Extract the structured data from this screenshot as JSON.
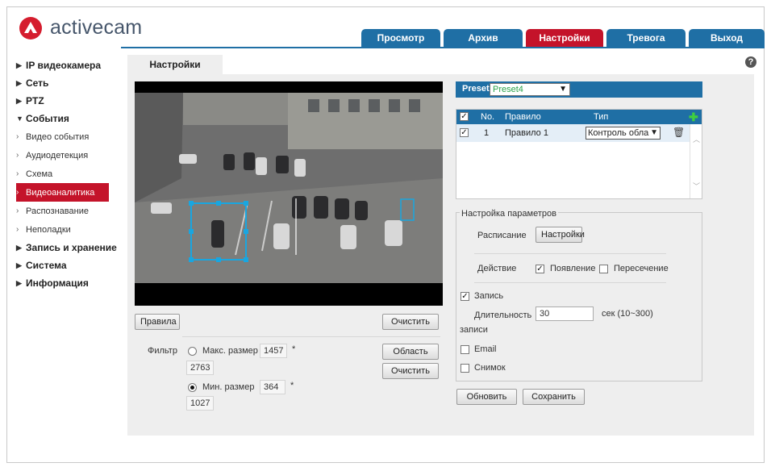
{
  "brand": {
    "name": "activecam"
  },
  "colors": {
    "accent": "#1f6fa5",
    "active": "#c4132a",
    "panel": "#eeeeee",
    "preset_value": "#2aa34a"
  },
  "topnav": [
    {
      "label": "Просмотр",
      "active": false
    },
    {
      "label": "Архив",
      "active": false
    },
    {
      "label": "Настройки",
      "active": true
    },
    {
      "label": "Тревога",
      "active": false
    },
    {
      "label": "Выход",
      "active": false
    }
  ],
  "sidebar": {
    "items": [
      {
        "label": "IP видеокамера"
      },
      {
        "label": "Сеть"
      },
      {
        "label": "PTZ"
      },
      {
        "label": "События"
      }
    ],
    "subitems": [
      {
        "label": "Видео события"
      },
      {
        "label": "Аудиодетекция"
      },
      {
        "label": "Схема"
      },
      {
        "label": "Видеоаналитика"
      },
      {
        "label": "Распознавание"
      },
      {
        "label": "Неполадки"
      }
    ],
    "items_after": [
      {
        "label": "Запись и хранение"
      },
      {
        "label": "Система"
      },
      {
        "label": "Информация"
      }
    ]
  },
  "page": {
    "tab": "Настройки",
    "help_icon": "?"
  },
  "left": {
    "rules_button": "Правила",
    "clear_button_1": "Очистить",
    "filter_label": "Фильтр",
    "max_size_label": "Макс. размер",
    "max_w": "1457",
    "max_h": "2763",
    "times": "*",
    "min_size_label": "Мин. размер",
    "min_w": "364",
    "min_h": "1027",
    "area_button": "Область",
    "clear_button_2": "Очистить"
  },
  "preset": {
    "label": "Preset",
    "value": "Preset4"
  },
  "rules_table": {
    "headers": {
      "no": "No.",
      "rule": "Правило",
      "type": "Тип"
    },
    "rows": [
      {
        "no": "1",
        "rule": "Правило 1",
        "type": "Контроль обла"
      }
    ]
  },
  "params": {
    "legend": "Настройка параметров",
    "schedule_label": "Расписание",
    "schedule_button": "Настройки",
    "action_label": "Действие",
    "appearance_label": "Появление",
    "crossing_label": "Пересечение",
    "record_label": "Запись",
    "duration_label_1": "Длительность",
    "duration_label_2": "записи",
    "duration_value": "30",
    "duration_unit": "сек (10~300)",
    "email_label": "Email",
    "snapshot_label": "Снимок"
  },
  "footer": {
    "update_button": "Обновить",
    "save_button": "Сохранить"
  }
}
